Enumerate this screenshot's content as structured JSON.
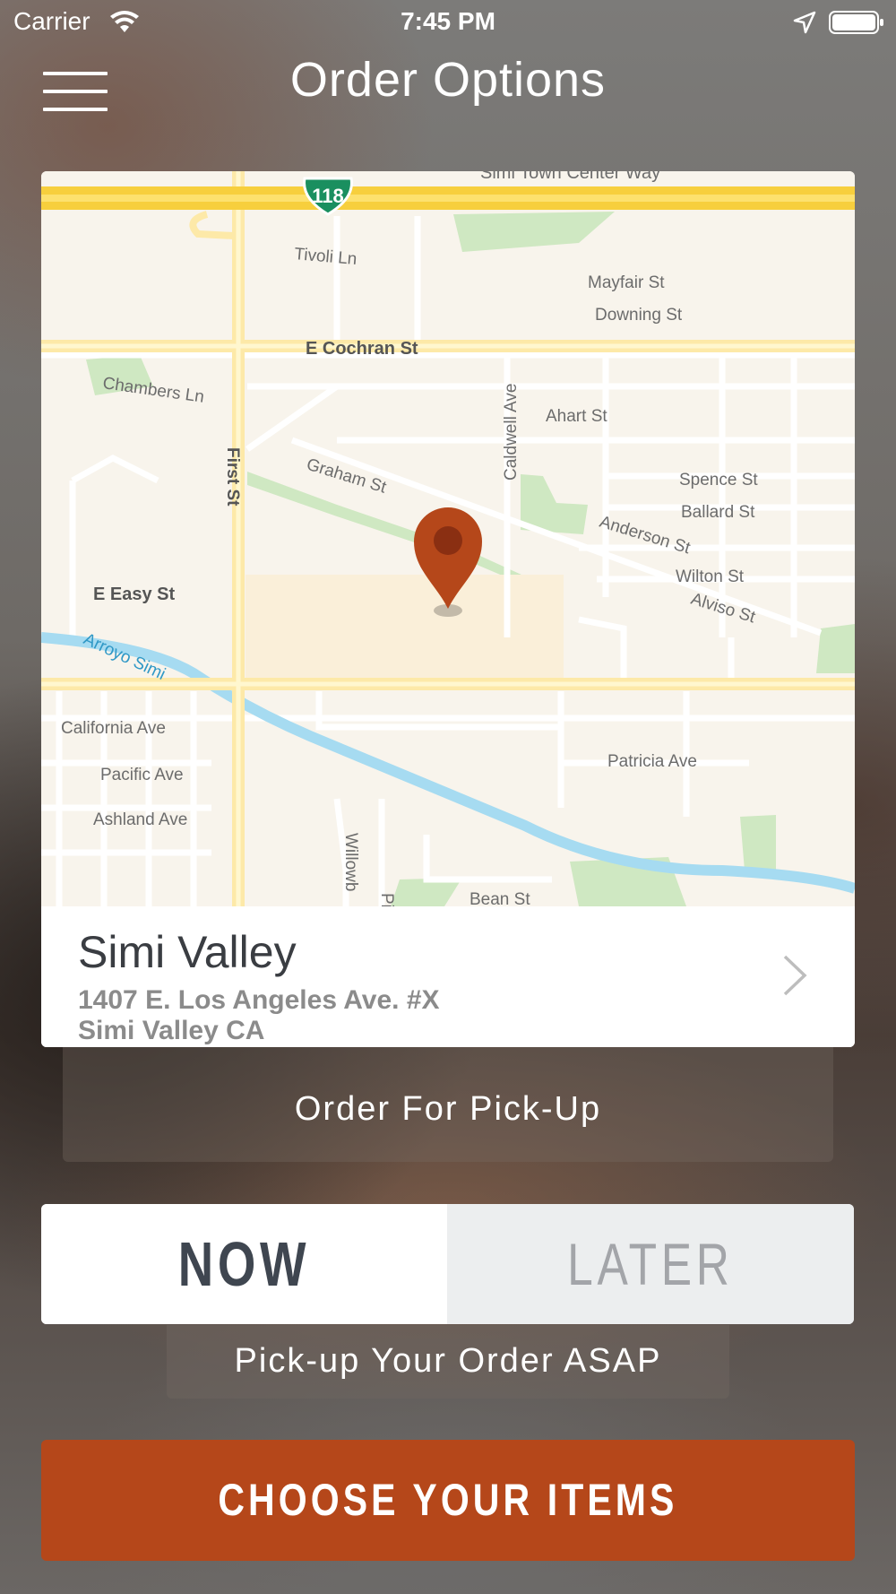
{
  "status_bar": {
    "carrier": "Carrier",
    "time": "7:45 PM",
    "icons": [
      "wifi-icon",
      "location-arrow-icon",
      "battery-icon"
    ]
  },
  "header": {
    "menu_icon": "hamburger-menu-icon",
    "title": "Order Options"
  },
  "map": {
    "highway_shield": "118",
    "streets": [
      "Simi Town Center Way",
      "Tivoli Ln",
      "Mayfair St",
      "Downing St",
      "E Cochran St",
      "Chambers Ln",
      "Caldwell Ave",
      "Ahart St",
      "First St",
      "Graham St",
      "Spence St",
      "Ballard St",
      "Anderson St",
      "E Easy St",
      "Wilton St",
      "Alviso St",
      "Arroyo Simi",
      "California Ave",
      "Patricia Ave",
      "Pacific Ave",
      "Ashland Ave",
      "Willowb",
      "Pi",
      "Bean St"
    ],
    "pin_icon": "map-pin-icon",
    "colors": {
      "pin": "#b5471a",
      "highway": "#fbd64c",
      "water": "#a6dbf1",
      "park": "#cfe8c2",
      "land": "#f8f4ec"
    }
  },
  "location": {
    "name": "Simi Valley",
    "address_line1": "1407 E. Los Angeles Ave. #X",
    "address_line2": "Simi Valley CA",
    "chevron_icon": "chevron-right-icon"
  },
  "order_type": {
    "label": "Order For Pick-Up"
  },
  "time_toggle": {
    "now_label": "NOW",
    "later_label": "LATER",
    "selected": "NOW"
  },
  "time_hint": "Pick-up Your Order ASAP",
  "cta": {
    "label": "CHOOSE YOUR ITEMS",
    "color": "#b5471a"
  }
}
